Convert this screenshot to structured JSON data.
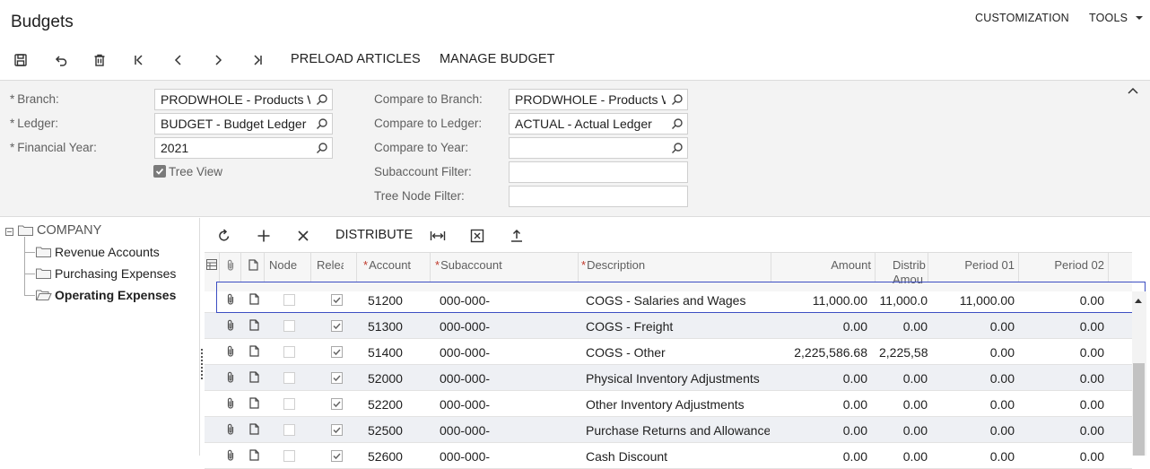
{
  "header": {
    "title": "Budgets",
    "customization": "CUSTOMIZATION",
    "tools": "TOOLS"
  },
  "toolbar": {
    "preload": "PRELOAD ARTICLES",
    "manage": "MANAGE BUDGET"
  },
  "form": {
    "required_mark": "*",
    "branch_label": "Branch:",
    "branch_value": "PRODWHOLE - Products Wh",
    "ledger_label": "Ledger:",
    "ledger_value": "BUDGET - Budget Ledger",
    "year_label": "Financial Year:",
    "year_value": "2021",
    "tree_view_label": "Tree View",
    "cmp_branch_label": "Compare to Branch:",
    "cmp_branch_value": "PRODWHOLE - Products Wh",
    "cmp_ledger_label": "Compare to Ledger:",
    "cmp_ledger_value": "ACTUAL - Actual Ledger",
    "cmp_year_label": "Compare to Year:",
    "cmp_year_value": "",
    "subaccount_filter_label": "Subaccount Filter:",
    "subaccount_filter_value": "",
    "tree_node_filter_label": "Tree Node Filter:",
    "tree_node_filter_value": ""
  },
  "tree": {
    "root": "COMPANY",
    "items": [
      "Revenue Accounts",
      "Purchasing Expenses",
      "Operating Expenses"
    ]
  },
  "grid_toolbar": {
    "distribute": "DISTRIBUTE"
  },
  "grid": {
    "columns": {
      "node": "Node",
      "released": "Relea",
      "account": "Account",
      "subaccount": "Subaccount",
      "description": "Description",
      "amount": "Amount",
      "distributed_line1": "Distrib",
      "distributed_line2": "Amou",
      "period01": "Period 01",
      "period02": "Period 02"
    },
    "rows": [
      {
        "account": "51200",
        "subaccount": "000-000-",
        "description": "COGS - Salaries and Wages",
        "amount": "11,000.00",
        "distributed": "11,000.0",
        "p01": "11,000.00",
        "p02": "0.00"
      },
      {
        "account": "51300",
        "subaccount": "000-000-",
        "description": "COGS - Freight",
        "amount": "0.00",
        "distributed": "0.00",
        "p01": "0.00",
        "p02": "0.00"
      },
      {
        "account": "51400",
        "subaccount": "000-000-",
        "description": "COGS - Other",
        "amount": "2,225,586.68",
        "distributed": "2,225,58",
        "p01": "0.00",
        "p02": "0.00"
      },
      {
        "account": "52000",
        "subaccount": "000-000-",
        "description": "Physical Inventory Adjustments",
        "amount": "0.00",
        "distributed": "0.00",
        "p01": "0.00",
        "p02": "0.00"
      },
      {
        "account": "52200",
        "subaccount": "000-000-",
        "description": "Other Inventory Adjustments",
        "amount": "0.00",
        "distributed": "0.00",
        "p01": "0.00",
        "p02": "0.00"
      },
      {
        "account": "52500",
        "subaccount": "000-000-",
        "description": "Purchase Returns and Allowances",
        "amount": "0.00",
        "distributed": "0.00",
        "p01": "0.00",
        "p02": "0.00"
      },
      {
        "account": "52600",
        "subaccount": "000-000-",
        "description": "Cash Discount",
        "amount": "0.00",
        "distributed": "0.00",
        "p01": "0.00",
        "p02": "0.00"
      }
    ]
  }
}
